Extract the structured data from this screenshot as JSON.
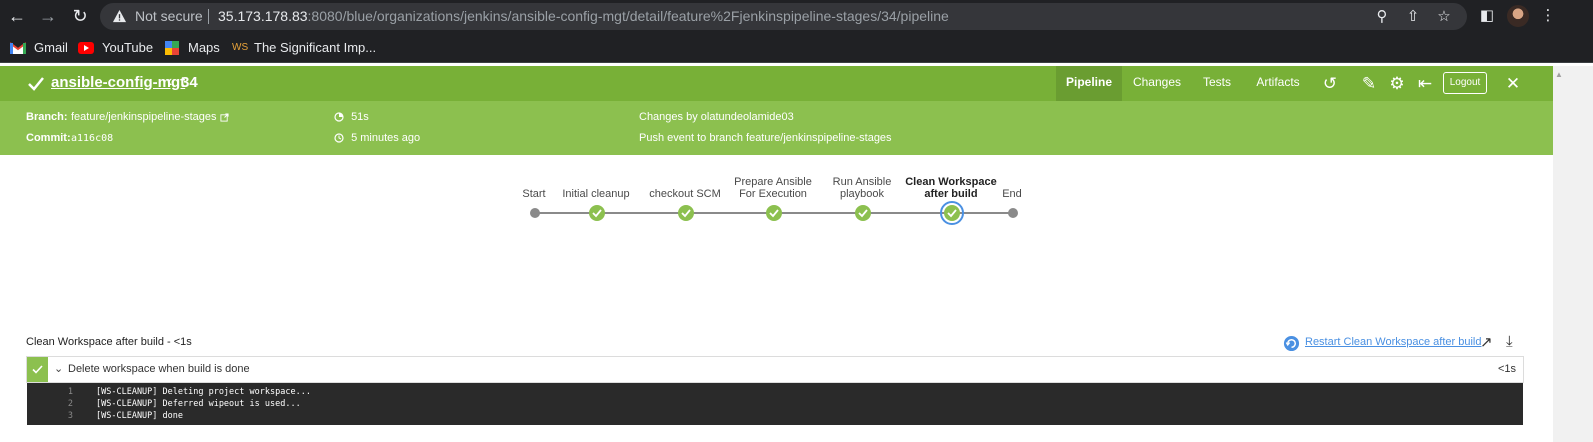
{
  "browser": {
    "security_label": "Not secure",
    "url_host": "35.173.178.83",
    "url_rest": ":8080/blue/organizations/jenkins/ansible-config-mgt/detail/feature%2Fjenkinspipeline-stages/34/pipeline",
    "bookmarks": [
      {
        "label": "Gmail",
        "icon": "gmail-icon"
      },
      {
        "label": "YouTube",
        "icon": "youtube-icon"
      },
      {
        "label": "Maps",
        "icon": "maps-icon"
      },
      {
        "label": "The Significant Imp...",
        "icon": "ws-icon"
      }
    ]
  },
  "run": {
    "job_name": "ansible-config-mgt",
    "run_number": "34",
    "status_icon": "check-icon"
  },
  "tabs": [
    "Pipeline",
    "Changes",
    "Tests",
    "Artifacts"
  ],
  "logout_label": "Logout",
  "info": {
    "branch_label": "Branch:",
    "branch_value": "feature/jenkinspipeline-stages",
    "commit_label": "Commit:",
    "commit_value": "a116c08",
    "duration": "51s",
    "started": "5 minutes ago",
    "changes_by": "Changes by olatundeolamide03",
    "cause": "Push event to branch feature/jenkinspipeline-stages"
  },
  "stages": [
    {
      "label_line1": "Start",
      "label_line2": "",
      "status": "none"
    },
    {
      "label_line1": "Initial cleanup",
      "label_line2": "",
      "status": "success"
    },
    {
      "label_line1": "checkout SCM",
      "label_line2": "",
      "status": "success"
    },
    {
      "label_line1": "Prepare Ansible",
      "label_line2": "For Execution",
      "status": "success"
    },
    {
      "label_line1": "Run Ansible",
      "label_line2": "playbook",
      "status": "success"
    },
    {
      "label_line1": "Clean Workspace",
      "label_line2": "after build",
      "status": "success-selected"
    },
    {
      "label_line1": "End",
      "label_line2": "",
      "status": "none"
    }
  ],
  "step_panel": {
    "title": "Clean Workspace after build - <1s",
    "restart_label": "Restart Clean Workspace after build",
    "step_name": "Delete workspace when build is done",
    "step_duration": "<1s",
    "log_lines": [
      {
        "n": "1",
        "text": "[WS-CLEANUP] Deleting project workspace..."
      },
      {
        "n": "2",
        "text": "[WS-CLEANUP] Deferred wipeout is used..."
      },
      {
        "n": "3",
        "text": "[WS-CLEANUP] done"
      }
    ]
  },
  "colors": {
    "header_green": "#78b037",
    "info_green": "#8cc04f",
    "success_node": "#8cc04f",
    "selected_ring": "#4a90e2",
    "log_bg": "#2a2a2a"
  }
}
